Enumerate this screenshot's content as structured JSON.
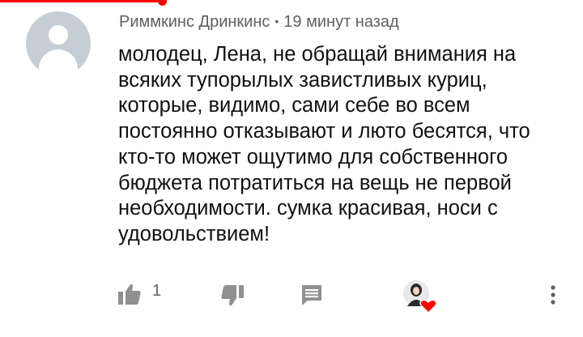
{
  "comment": {
    "author": "Риммкинс Дринкинс",
    "separator": "•",
    "timestamp": "19 минут назад",
    "text": "молодец, Лена, не обращай внимания на всяких тупорылых завистливых куриц, которые, видимо, сами себе во всем постоянно отказывают и люто бесятся, что кто-то может ощутимо для собственного бюджета потратиться на вещь не первой необходимости. сумка красивая, носи с удовольствием!"
  },
  "actions": {
    "like_count": "1"
  },
  "icons": {
    "like": "thumbs-up-icon",
    "dislike": "thumbs-down-icon",
    "reply": "reply-icon",
    "heart": "creator-heart-icon",
    "more": "more-vertical-icon"
  },
  "colors": {
    "accent": "#ff0000",
    "text": "#111111",
    "secondary": "#606060",
    "icon": "#909090",
    "avatar_bg": "#c6cdd4"
  }
}
